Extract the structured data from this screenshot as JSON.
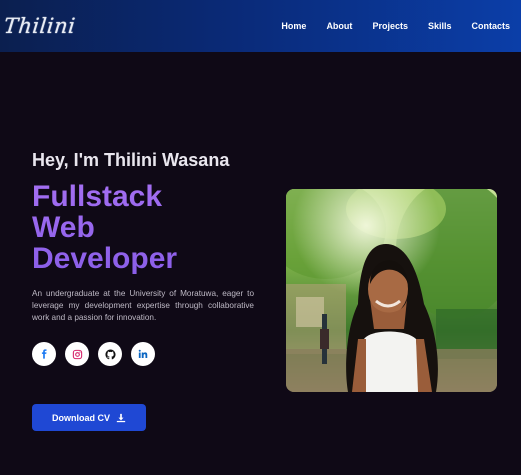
{
  "navbar": {
    "logo": "Thilini",
    "links": [
      "Home",
      "About",
      "Projects",
      "Skills",
      "Contacts"
    ]
  },
  "hero": {
    "greeting": "Hey, I'm Thilini Wasana",
    "role_lines": [
      "Fullstack",
      "Web",
      "Developer"
    ],
    "intro": "An undergraduate at the University of Moratuwa, eager to leverage my development expertise through collaborative work and a passion for innovation.",
    "socials": [
      {
        "name": "facebook-icon",
        "color": "#1877f2"
      },
      {
        "name": "instagram-icon",
        "color": "#e1306c"
      },
      {
        "name": "github-icon",
        "color": "#111111"
      },
      {
        "name": "linkedin-icon",
        "color": "#0a66c2"
      }
    ],
    "cv_button": "Download CV",
    "cv_icon": "download-icon"
  },
  "colors": {
    "background": "#0f0916",
    "accent": "#9a6bf0",
    "button": "#1f48d4"
  }
}
